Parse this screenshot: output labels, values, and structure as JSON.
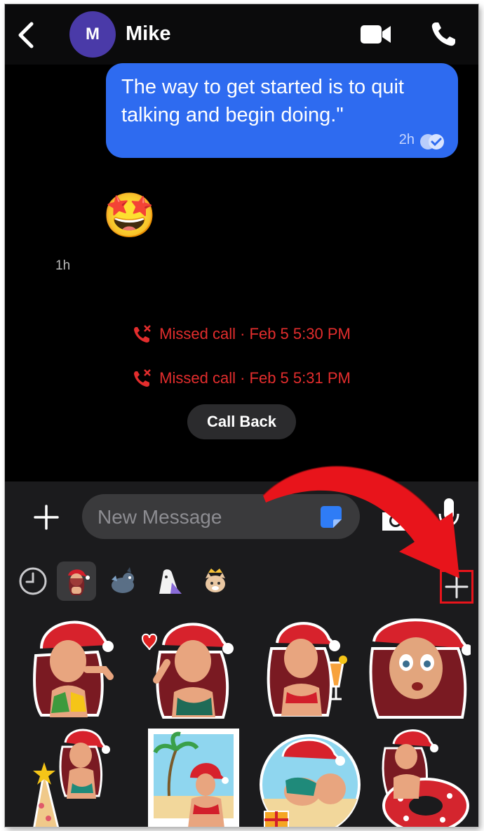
{
  "header": {
    "avatar_initial": "M",
    "contact_name": "Mike"
  },
  "messages": {
    "outgoing_text": "The way to get started is to quit talking and begin doing.\"",
    "outgoing_time": "2h",
    "emojis": [
      "🙃",
      "🤩",
      "😍",
      "😍"
    ],
    "emoji_time": "1h",
    "missed_calls": [
      "Missed call · Feb 5 5:30 PM",
      "Missed call · Feb 5 5:31 PM"
    ],
    "call_back_label": "Call Back"
  },
  "composer": {
    "placeholder": "New Message"
  },
  "sticker_tray": {
    "tabs": [
      "recent-icon",
      "christmas-girl-pack",
      "dragon-pack",
      "ghost-pack",
      "cat-king-pack"
    ],
    "active_tab": 1,
    "stickers": [
      "girl-santa-hat-crying",
      "girl-santa-hat-heart",
      "girl-santa-hat-drink",
      "girl-santa-hat-shocked",
      "girl-sandcastle",
      "girl-beach-photo",
      "girl-beach-gift",
      "girl-swim-ring"
    ]
  },
  "colors": {
    "bubble": "#2e6bf0",
    "missed": "#e32d2d",
    "highlight": "#e8141b",
    "avatar": "#4a3aa8"
  }
}
